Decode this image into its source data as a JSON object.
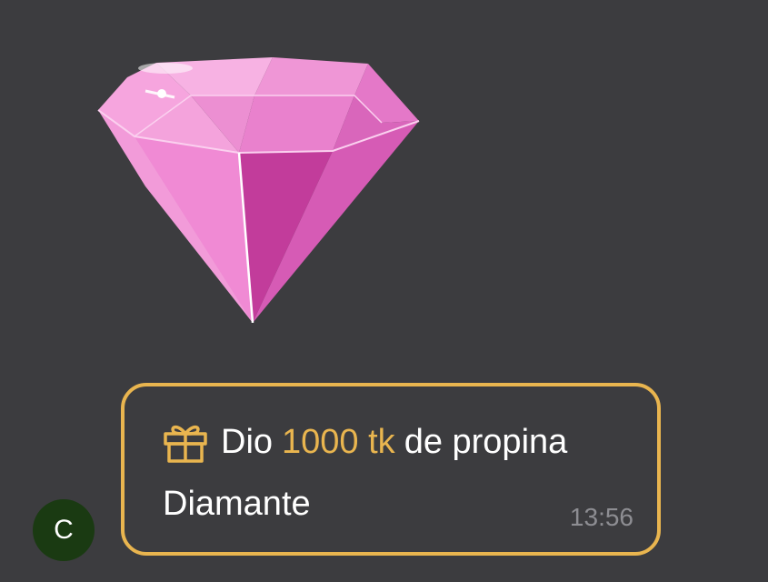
{
  "gift_image": {
    "icon": "pink-diamond-sticker",
    "colors": {
      "light": "#f6a5de",
      "mid": "#e46fc6",
      "deep": "#c8409f",
      "dark": "#a92f86"
    }
  },
  "sender": {
    "avatar_initial": "C",
    "avatar_color": "#1a3a12"
  },
  "message": {
    "icon": "gift-icon",
    "prefix": "Dio",
    "amount": "1000 tk",
    "suffix": "de propina",
    "gift_name": "Diamante",
    "time": "13:56",
    "accent_color": "#e9b54f"
  }
}
